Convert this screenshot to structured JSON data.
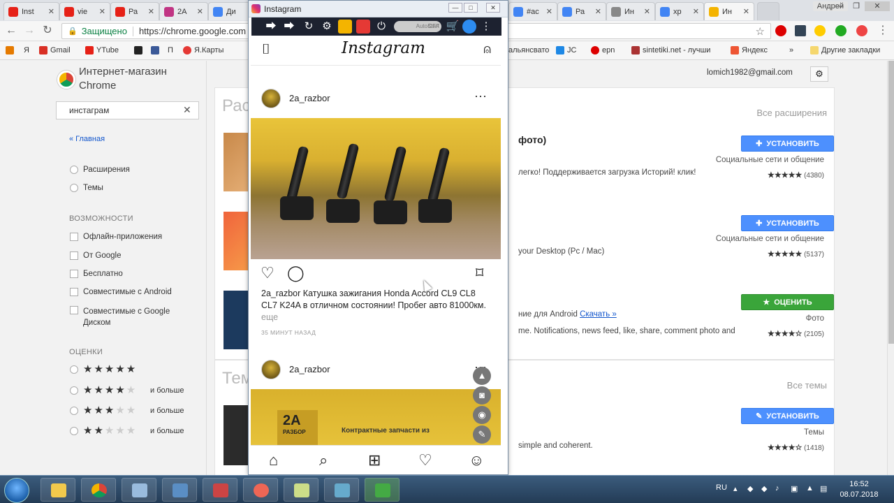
{
  "browser": {
    "tabs": [
      {
        "label": "Inst",
        "color": "#e62117"
      },
      {
        "label": "vie",
        "color": "#e62117"
      },
      {
        "label": "Ра",
        "color": "#e62117"
      },
      {
        "label": "2A",
        "color": "#c13584"
      },
      {
        "label": "Ди",
        "color": "#4285f4"
      },
      {
        "label": "#ас",
        "color": "#4285f4"
      },
      {
        "label": "Ра",
        "color": "#4285f4"
      },
      {
        "label": "Ин",
        "color": "#888888"
      },
      {
        "label": "хр",
        "color": "#4285f4"
      },
      {
        "label": "Ин",
        "color": "#f4b400"
      }
    ],
    "user": "Андрей",
    "security_label": "Защищено",
    "url": "https://chrome.google.com",
    "bookmarks": [
      "Я",
      "Gmail",
      "YTube",
      "П",
      "Я.Карты",
      "альянсвато",
      "JC",
      "epn",
      "sintetiki.net - лучши",
      "Яндекс",
      "Другие закладки"
    ]
  },
  "store": {
    "title": "Интернет-магазин Chrome",
    "search_value": "инстаграм",
    "home_link": "« Главная",
    "types": [
      "Расширения",
      "Темы"
    ],
    "features_header": "ВОЗМОЖНОСТИ",
    "features": [
      "Офлайн-приложения",
      "От Google",
      "Бесплатно",
      "Совместимые с Android",
      "Совместимые с Google Диском"
    ],
    "ratings_header": "ОЦЕНКИ",
    "and_more": "и больше",
    "account": "lomich1982@gmail.com",
    "section_extensions": "Расш",
    "all_extensions": "Все расширения",
    "section_themes": "Темы",
    "all_themes": "Все темы",
    "results": [
      {
        "title_tail": "фото)",
        "desc": "легко! Поддерживается загрузка Историй! клик!",
        "button": "УСТАНОВИТЬ",
        "category": "Социальные сети и общение",
        "count": "(4380)",
        "stars": "★★★★★"
      },
      {
        "desc": "your Desktop (Pc / Mac)",
        "button": "УСТАНОВИТЬ",
        "category": "Социальные сети и общение",
        "count": "(5137)",
        "stars": "★★★★★"
      },
      {
        "desc": "ние для Android",
        "link": "Скачать »",
        "desc2": "me. Notifications, news feed, like, share, comment photo and",
        "button": "ОЦЕНИТЬ",
        "category": "Фото",
        "count": "(2105)",
        "stars": "★★★★☆"
      },
      {
        "desc": "simple and coherent.",
        "button": "УСТАНОВИТЬ",
        "category": "Темы",
        "count": "(1418)",
        "stars": "★★★★☆"
      }
    ]
  },
  "instagram": {
    "window_title": "Instagram",
    "autostart": "AutoStart",
    "autostart_state": "OFF",
    "logo": "Instagram",
    "post1": {
      "user": "2a_razbor",
      "caption_user": "2a_razbor",
      "caption": "Катушка зажигания Honda Accord CL9 CL8 CL7 K24A в отличном состоянии! Пробег авто 81000км.",
      "more": "еще",
      "time": "35 МИНУТ НАЗАД"
    },
    "post2": {
      "user": "2a_razbor",
      "logo_text": "2A",
      "logo_sub": "РАЗБОР",
      "banner": "Контрактные запчасти из"
    }
  },
  "taskbar": {
    "lang": "RU",
    "time": "16:52",
    "date": "08.07.2018"
  }
}
